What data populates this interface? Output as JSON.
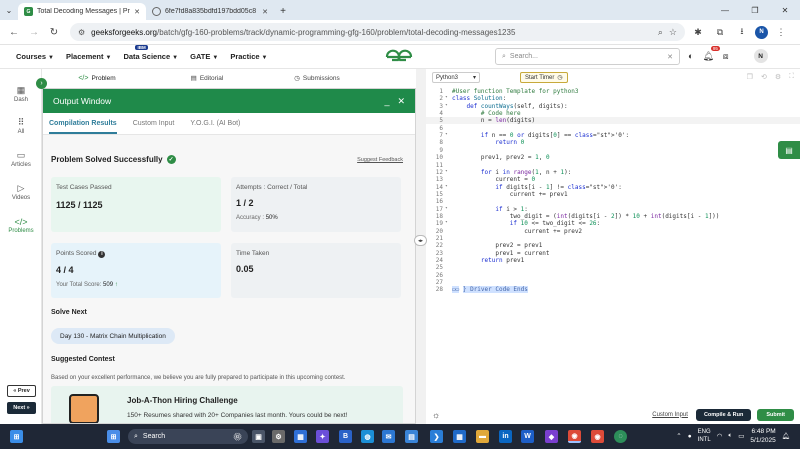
{
  "browser": {
    "tabs": [
      {
        "title": "Total Decoding Messages | Pra",
        "active": true
      },
      {
        "title": "6fe7fd8a835bdfd197bdd05c8",
        "active": false
      }
    ],
    "url_domain": "geeksforgeeks.org",
    "url_path": "/batch/gfg-160-problems/track/dynamic-programming-gfg-160/problem/total-decoding-messages1235",
    "profile_initial": "N"
  },
  "gfg_nav": {
    "items": [
      "Courses",
      "Placement",
      "Data Science",
      "GATE",
      "Practice"
    ],
    "ibm_badge": "IBM",
    "logo": "GG",
    "search_placeholder": "Search...",
    "notification_count": "95",
    "avatar_initial": "N"
  },
  "sidebar": {
    "items": [
      "Dash",
      "All",
      "Articles",
      "Videos",
      "Problems"
    ],
    "prev_label": "« Prev",
    "next_label": "Next »"
  },
  "problem_tabs": [
    "Problem",
    "Editorial",
    "Submissions"
  ],
  "output": {
    "title": "Output Window",
    "tabs": [
      "Compilation Results",
      "Custom Input",
      "Y.O.G.I. (AI Bot)"
    ],
    "status": "Problem Solved Successfully",
    "feedback": "Suggest Feedback",
    "test_cases_label": "Test Cases Passed",
    "test_cases_value": "1125 / 1125",
    "attempts_label": "Attempts : Correct / Total",
    "attempts_value": "1 / 2",
    "accuracy_label": "Accuracy :",
    "accuracy_value": "50%",
    "points_label": "Points Scored",
    "points_value": "4 / 4",
    "total_score_label": "Your Total Score:",
    "total_score_value": "509",
    "time_label": "Time Taken",
    "time_value": "0.05",
    "solve_next_heading": "Solve Next",
    "solve_next_item": "Day 130 - Matrix Chain Multiplication",
    "contest_heading": "Suggested Contest",
    "contest_text": "Based on your excellent performance, we believe you are fully prepared to participate in this upcoming contest.",
    "banner_title": "Job-A-Thon Hiring Challenge",
    "banner_subtitle": "150+ Resumes shared with 20+ Companies last month. Yours could be next!"
  },
  "editor": {
    "language": "Python3",
    "timer_label": "Start Timer",
    "custom_input": "Custom Input",
    "compile_run": "Compile & Run",
    "submit": "Submit",
    "lines": [
      "#User function Template for python3",
      "class Solution:",
      "    def countWays(self, digits):",
      "        # Code here",
      "        n = len(digits)",
      "",
      "        if n == 0 or digits[0] == '0':",
      "            return 0",
      "",
      "        prev1, prev2 = 1, 0",
      "",
      "        for i in range(1, n + 1):",
      "            current = 0",
      "            if digits[i - 1] != '0':",
      "                current += prev1",
      "",
      "            if i > 1:",
      "                two_digit = (int(digits[i - 2]) * 10 + int(digits[i - 1]))",
      "                if 10 <= two_digit <= 26:",
      "                    current += prev2",
      "",
      "            prev2 = prev1",
      "            prev1 = current",
      "        return prev1",
      "",
      "",
      "",
      "} Driver Code Ends"
    ],
    "line_numbers": [
      "1",
      "2",
      "3",
      "4",
      "5",
      "6",
      "7",
      "8",
      "9",
      "10",
      "11",
      "12",
      "13",
      "14",
      "15",
      "16",
      "17",
      "18",
      "19",
      "20",
      "21",
      "22",
      "23",
      "24",
      "25",
      "26",
      "27",
      "28"
    ]
  },
  "taskbar": {
    "search_label": "Search",
    "lang_top": "ENG",
    "lang_bottom": "INTL",
    "time": "6:48 PM",
    "date": "5/1/2025"
  }
}
